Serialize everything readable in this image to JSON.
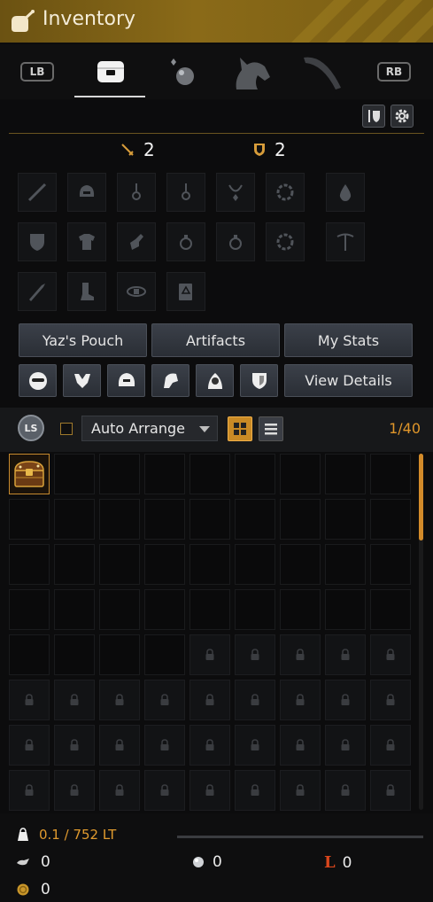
{
  "window": {
    "title": "Inventory"
  },
  "tabs": {
    "left_bumper": "LB",
    "right_bumper": "RB",
    "items": [
      {
        "name": "bag",
        "active": true
      },
      {
        "name": "pearl",
        "active": false
      },
      {
        "name": "horse",
        "active": false
      },
      {
        "name": "tools",
        "active": false
      }
    ]
  },
  "stats": {
    "attack": "2",
    "defense": "2"
  },
  "buttons": {
    "yaz_pouch": "Yaz's Pouch",
    "artifacts": "Artifacts",
    "my_stats": "My Stats",
    "view_details": "View Details"
  },
  "arrange": {
    "label": "Auto Arrange",
    "ls": "LS",
    "count": "1/40"
  },
  "footer": {
    "weight": "0.1 / 752 LT",
    "silver": "0",
    "pearls": "0",
    "loyalty": "0",
    "gold": "0"
  },
  "colors": {
    "accent": "#8a6a18",
    "highlight": "#e0962a"
  }
}
